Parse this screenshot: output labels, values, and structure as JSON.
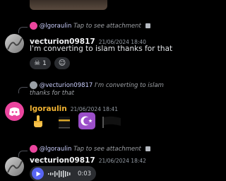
{
  "colors": {
    "background": "#000000",
    "discord_blurple": "#5865f2",
    "discord_pink": "#eb459e",
    "reply_name": "#c9cdfb",
    "timestamp": "#949ba4"
  },
  "messages": [
    {
      "reply": {
        "name": "@lgoraulin",
        "text": "Tap to see attachment",
        "icon": "image-icon"
      },
      "username": "vecturion09817",
      "timestamp": "21/06/2024 18:40",
      "text": "I'm converting to islam thanks for that",
      "reactions": [
        {
          "emoji": "skull",
          "count": "1"
        }
      ],
      "add_reaction_icon": "add-reaction-icon"
    },
    {
      "reply": {
        "name": "@vecturion09817",
        "text": "I'm converting to islam thanks for that"
      },
      "username": "lgoraulin",
      "timestamp": "21/06/2024 18:41",
      "emojis": [
        "middle-finger-emoji",
        "kaaba-emoji",
        "star-and-crescent-emoji",
        "black-flag-emoji"
      ]
    },
    {
      "reply": {
        "name": "@lgoraulin",
        "text": "Tap to see attachment",
        "icon": "image-icon"
      },
      "username": "vecturion09817",
      "timestamp": "21/06/2024 18:42",
      "voice_message": {
        "duration": "0:03",
        "icon": "play-icon"
      }
    }
  ]
}
